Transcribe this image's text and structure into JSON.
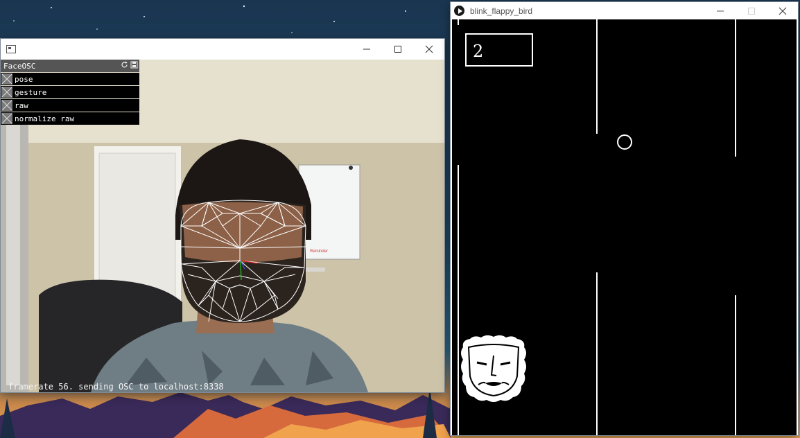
{
  "faceosc_window": {
    "panel": {
      "title": "FaceOSC",
      "options": [
        {
          "label": "pose",
          "checked": false
        },
        {
          "label": "gesture",
          "checked": false
        },
        {
          "label": "raw",
          "checked": false
        },
        {
          "label": "normalize raw",
          "checked": false
        }
      ]
    },
    "status": "framerate 56. sending OSC to localhost:8338",
    "whiteboard_note": "Reminder"
  },
  "flappy_window": {
    "title": "blink_flappy_bird",
    "score": "2"
  },
  "colors": {
    "game_background": "#000000",
    "game_foreground": "#ffffff",
    "mesh": "#ffffff",
    "panel_row": "#000000",
    "panel_header": "#555555"
  },
  "icons": [
    "app-icon",
    "minimize-icon",
    "maximize-icon",
    "close-icon",
    "refresh-icon",
    "save-icon",
    "checkbox-x-icon",
    "play-icon",
    "mask-icon",
    "bird-icon"
  ]
}
